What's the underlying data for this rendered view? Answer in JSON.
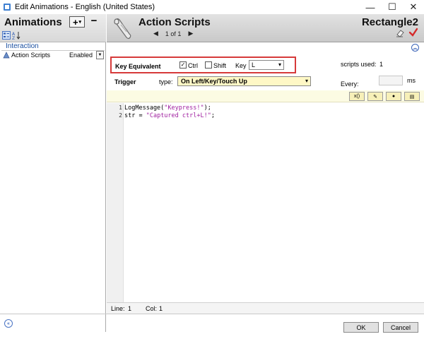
{
  "window": {
    "title": "Edit Animations - English (United States)",
    "minimize": "—",
    "maximize": "☐",
    "close": "✕"
  },
  "left_panel": {
    "heading": "Animations",
    "add_label": "+",
    "add_caret": "▾",
    "remove_label": "−",
    "section": "Interaction",
    "items": [
      {
        "name": "Action Scripts",
        "status": "Enabled",
        "dropdown": "▼"
      }
    ],
    "collapse_glyph": "«"
  },
  "header": {
    "title": "Action Scripts",
    "pager": {
      "prev": "◀",
      "text": "1 of 1",
      "next": "▶"
    },
    "object_name": "Rectangle2"
  },
  "key_equivalent": {
    "label": "Key Equivalent",
    "ctrl_label": "Ctrl",
    "ctrl_checked": "✓",
    "shift_label": "Shift",
    "key_label": "Key",
    "key_value": "L",
    "arrow": "▾"
  },
  "trigger": {
    "label": "Trigger",
    "type_label": "type:",
    "type_value": "On Left/Key/Touch Up",
    "arrow": "▾"
  },
  "scripts_used": {
    "label": "scripts used:",
    "value": "1"
  },
  "every": {
    "label": "Every:",
    "unit": "ms"
  },
  "toolbar": {
    "buttons": [
      "x()",
      "✎",
      "●",
      "▤"
    ]
  },
  "editor": {
    "lines": [
      {
        "number": "1",
        "pre": "LogMessage(",
        "str": "\"Keypress!\"",
        "post": ");"
      },
      {
        "number": "2",
        "pre": "str = ",
        "str": "\"Captured ctrl+L!\"",
        "post": ";"
      }
    ]
  },
  "status": {
    "line_label": "Line:",
    "line_value": "1",
    "col_label": "Col:",
    "col_value": "1"
  },
  "buttons": {
    "ok": "OK",
    "cancel": "Cancel"
  }
}
